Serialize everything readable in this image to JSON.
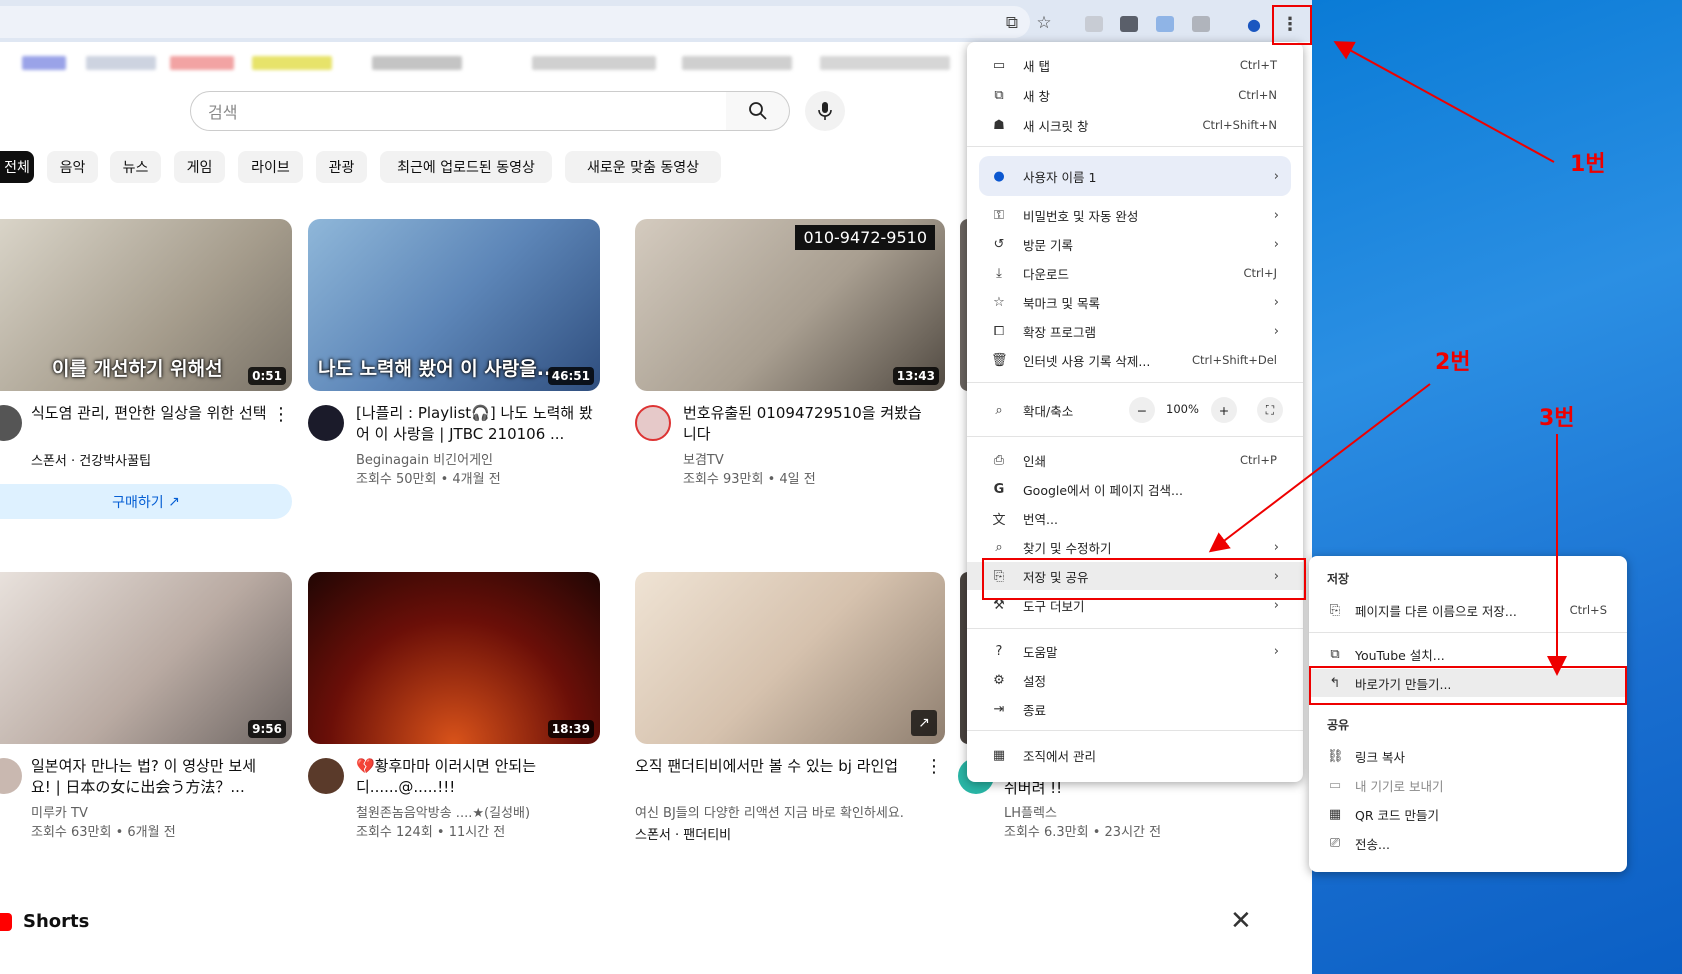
{
  "search": {
    "placeholder": "검색"
  },
  "chips": [
    "전체",
    "음악",
    "뉴스",
    "게임",
    "라이브",
    "관광",
    "최근에 업로드된 동영상",
    "새로운 맞춤 동영상"
  ],
  "videos": [
    {
      "caption": "이를 개선하기 위해선",
      "duration": "0:51",
      "title": "식도염 관리, 편안한 일상을 위한 선택",
      "channel": "스폰서 · 건강박사꿀팁",
      "stats": "",
      "cta": "구매하기"
    },
    {
      "caption": "나도 노력해 봤어 이 사랑을...",
      "duration": "46:51",
      "title": "[나플리 : Playlist🎧] 나도 노력해 봤어 이 사랑을 | JTBC 210106 ...",
      "channel": "Beginagain 비긴어게인",
      "stats": "조회수 50만회 • 4개월 전"
    },
    {
      "caption": "010-9472-9510",
      "duration": "13:43",
      "title": "번호유출된 01094729510을 켜봤습니다",
      "channel": "보겸TV",
      "stats": "조회수 93만회 • 4일 전"
    },
    {
      "caption": "",
      "duration": "9:56",
      "title": "일본여자 만나는 법? 이 영상만 보세요! | 日本の女に出会う方法？...",
      "channel": "미루카 TV",
      "stats": "조회수 63만회 • 6개월 전"
    },
    {
      "caption": "",
      "duration": "18:39",
      "title": "💔황후마마 이러시면 안되는 디......@.....!!!",
      "channel": "철원존놈음악방송 ....★(길성배)",
      "stats": "조회수 124회 • 11시간 전"
    },
    {
      "caption": "",
      "duration": "",
      "title": "오직 팬더티비에서만 볼 수 있는 bj 라인업",
      "channel": "여신 BJ들의 다양한 리액션 지금 바로 확인하세요.",
      "stats": "스폰서 · 팬더티비"
    },
    {
      "caption": "",
      "duration": "",
      "title": "쉬버려 !!",
      "channel": "LH플렉스",
      "stats": "조회수 6.3만회 • 23시간 전"
    }
  ],
  "shorts_label": "Shorts",
  "menu": {
    "items": [
      {
        "icon": "new-tab-icon",
        "label": "새 탭",
        "shortcut": "Ctrl+T"
      },
      {
        "icon": "new-window-icon",
        "label": "새 창",
        "shortcut": "Ctrl+N"
      },
      {
        "icon": "incognito-icon",
        "label": "새 시크릿 창",
        "shortcut": "Ctrl+Shift+N"
      },
      {
        "icon": "profile-icon",
        "label": "사용자 이름 1"
      },
      {
        "icon": "key-icon",
        "label": "비밀번호 및 자동 완성"
      },
      {
        "icon": "history-icon",
        "label": "방문 기록"
      },
      {
        "icon": "download-icon",
        "label": "다운로드",
        "shortcut": "Ctrl+J"
      },
      {
        "icon": "star-icon",
        "label": "북마크 및 목록"
      },
      {
        "icon": "extension-icon",
        "label": "확장 프로그램"
      },
      {
        "icon": "trash-icon",
        "label": "인터넷 사용 기록 삭제...",
        "shortcut": "Ctrl+Shift+Del"
      },
      {
        "icon": "zoom-icon",
        "label": "확대/축소",
        "value": "100%"
      },
      {
        "icon": "print-icon",
        "label": "인쇄",
        "shortcut": "Ctrl+P"
      },
      {
        "icon": "google-icon",
        "label": "Google에서 이 페이지 검색..."
      },
      {
        "icon": "translate-icon",
        "label": "번역..."
      },
      {
        "icon": "find-icon",
        "label": "찾기 및 수정하기"
      },
      {
        "icon": "save-share-icon",
        "label": "저장 및 공유"
      },
      {
        "icon": "tools-icon",
        "label": "도구 더보기"
      },
      {
        "icon": "help-icon",
        "label": "도움말"
      },
      {
        "icon": "settings-icon",
        "label": "설정"
      },
      {
        "icon": "exit-icon",
        "label": "종료"
      },
      {
        "icon": "org-icon",
        "label": "조직에서 관리"
      }
    ]
  },
  "submenu": {
    "save_header": "저장",
    "save_as": "페이지를 다른 이름으로 저장...",
    "save_as_shortcut": "Ctrl+S",
    "install": "YouTube 설치...",
    "shortcut": "바로가기 만들기...",
    "share_header": "공유",
    "copy_link": "링크 복사",
    "send_devices": "내 기기로 보내기",
    "qr": "QR 코드 만들기",
    "cast": "전송..."
  },
  "annotations": {
    "a1": "1번",
    "a2": "2번",
    "a3": "3번"
  },
  "colors": {
    "annotation": "#ee0000",
    "accent": "#0b57d0",
    "desktop": "#1a7fe0"
  }
}
